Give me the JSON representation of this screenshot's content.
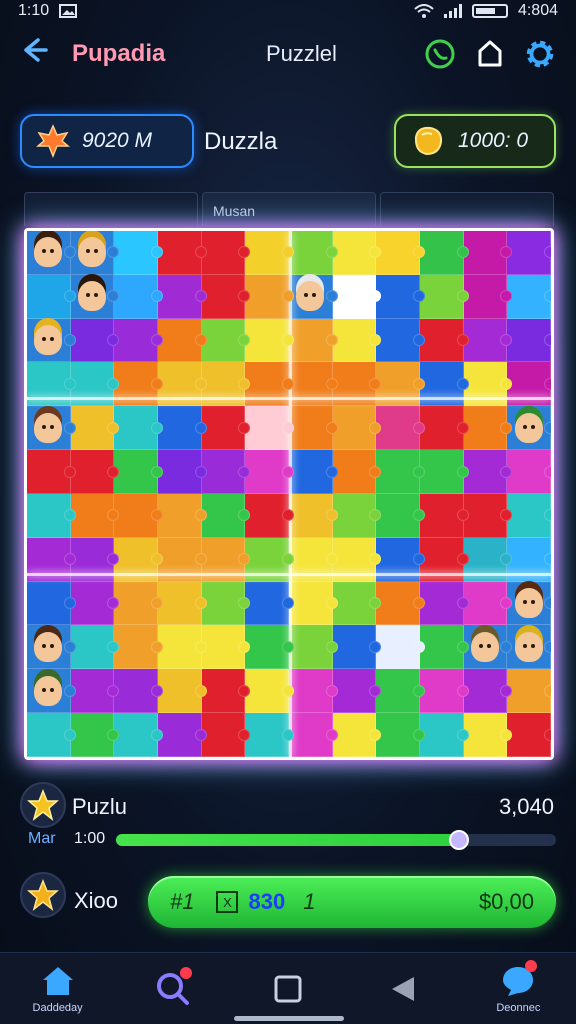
{
  "status_bar": {
    "time_left": "1:10",
    "time_right": "4:804"
  },
  "header": {
    "app_title": "Pupadia",
    "page_title": "Puzzlel"
  },
  "stats": {
    "left_value": "9020 M",
    "middle_label": "Duzzla",
    "right_value": "1000: 0"
  },
  "tabs": [
    "",
    "Musan",
    ""
  ],
  "progress": {
    "title": "Puzlu",
    "score": "3,040",
    "label_left": "Mar",
    "label_right": "1:00",
    "level": 0.78
  },
  "action": {
    "mode_label": "Xioo",
    "button": {
      "seg1": "#1",
      "box": "X",
      "value": "830",
      "seg2": "1",
      "price": "$0,00"
    }
  },
  "bottom_nav": [
    {
      "label": "Daddeday",
      "icon": "home-icon"
    },
    {
      "label": "",
      "icon": "search-icon"
    },
    {
      "label": "",
      "icon": "square-icon"
    },
    {
      "label": "",
      "icon": "back-triangle-icon"
    },
    {
      "label": "Deonnec",
      "icon": "chat-icon"
    }
  ],
  "board": {
    "rows": 12,
    "cols": 12,
    "colors": [
      [
        "#2f9cf0",
        "#f0a02a",
        "#29c6ff",
        "#e0202c",
        "#e0202c",
        "#f3d12a",
        "#7ad33a",
        "#f5e53b",
        "#f7d32b",
        "#35c24b",
        "#c51aa8",
        "#8a2be2"
      ],
      [
        "#1fa6e8",
        "#2ab3c8",
        "#2ea7ff",
        "#a02ad4",
        "#e0202c",
        "#f0a02a",
        "#f5e53b",
        "#ffffff",
        "#2168e0",
        "#7ad33a",
        "#c51aa8",
        "#33b3ff"
      ],
      [
        "#f07d1a",
        "#7a2be0",
        "#9a2bd8",
        "#f07d1a",
        "#7ad33a",
        "#f5e53b",
        "#f0a02a",
        "#f5e53b",
        "#2168e0",
        "#e0202c",
        "#a42ad6",
        "#7a2be0"
      ],
      [
        "#2bc6c6",
        "#2bc6c6",
        "#f07d1a",
        "#f0c02a",
        "#f0c02a",
        "#f07d1a",
        "#f07d1a",
        "#f07d1a",
        "#f0a02a",
        "#2168e0",
        "#f5e53b",
        "#c51aa8"
      ],
      [
        "#f0a02a",
        "#f0c02a",
        "#2bc6c6",
        "#2168e0",
        "#e0202c",
        "#ffccd6",
        "#f07d1a",
        "#f0a02a",
        "#e03a8a",
        "#e0202c",
        "#f07d1a",
        "#7ad33a"
      ],
      [
        "#e0202c",
        "#e0202c",
        "#34c64a",
        "#7a2be0",
        "#9a2bd8",
        "#e03ac8",
        "#2168e0",
        "#f07d1a",
        "#34c64a",
        "#34c64a",
        "#a42ad6",
        "#e03ac8"
      ],
      [
        "#2bc6c6",
        "#f07d1a",
        "#f07d1a",
        "#f0a02a",
        "#34c64a",
        "#e0202c",
        "#f0c02a",
        "#7ad33a",
        "#34c64a",
        "#e0202c",
        "#e0202c",
        "#2bc6c6"
      ],
      [
        "#a42ad6",
        "#9a2bd8",
        "#f0c02a",
        "#f0a02a",
        "#f0a02a",
        "#7ad33a",
        "#f5e53b",
        "#f5e53b",
        "#2168e0",
        "#e0202c",
        "#2ab3c8",
        "#33b3ff"
      ],
      [
        "#2168e0",
        "#a42ad6",
        "#f0a02a",
        "#f0c02a",
        "#7ad33a",
        "#2168e0",
        "#f5e53b",
        "#7ad33a",
        "#f07d1a",
        "#a42ad6",
        "#e03ac8",
        "#f0a02a"
      ],
      [
        "#2bc6c6",
        "#2bc6c6",
        "#f0a02a",
        "#f5e53b",
        "#f5e53b",
        "#34c64a",
        "#7ad33a",
        "#2168e0",
        "#e8f0ff",
        "#34c64a",
        "#e03ac8",
        "#f0a02a"
      ],
      [
        "#7ad33a",
        "#a42ad6",
        "#9a2bd8",
        "#f0c02a",
        "#e0202c",
        "#f5e53b",
        "#e03ac8",
        "#a42ad6",
        "#34c64a",
        "#e03ac8",
        "#a42ad6",
        "#f0a02a"
      ],
      [
        "#2bc6c6",
        "#34c64a",
        "#2bc6c6",
        "#9a2bd8",
        "#e0202c",
        "#2bc6c6",
        "#e03ac8",
        "#f5e53b",
        "#34c64a",
        "#2bc6c6",
        "#f5e53b",
        "#e0202c"
      ]
    ],
    "avatars": [
      {
        "r": 0,
        "c": 0,
        "hair": "#3a1e10"
      },
      {
        "r": 0,
        "c": 1,
        "hair": "#d9a21a"
      },
      {
        "r": 1,
        "c": 1,
        "hair": "#2a1608"
      },
      {
        "r": 1,
        "c": 6,
        "hair": "#e8e8e8"
      },
      {
        "r": 2,
        "c": 0,
        "hair": "#e6b21f"
      },
      {
        "r": 4,
        "c": 0,
        "hair": "#6b3a1f"
      },
      {
        "r": 4,
        "c": 11,
        "hair": "#2e8a2e"
      },
      {
        "r": 9,
        "c": 0,
        "hair": "#4a2a16"
      },
      {
        "r": 8,
        "c": 11,
        "hair": "#5a2a10"
      },
      {
        "r": 9,
        "c": 10,
        "hair": "#6a5a2a"
      },
      {
        "r": 9,
        "c": 11,
        "hair": "#d9b21f"
      },
      {
        "r": 10,
        "c": 0,
        "hair": "#3a6a2a"
      }
    ]
  }
}
